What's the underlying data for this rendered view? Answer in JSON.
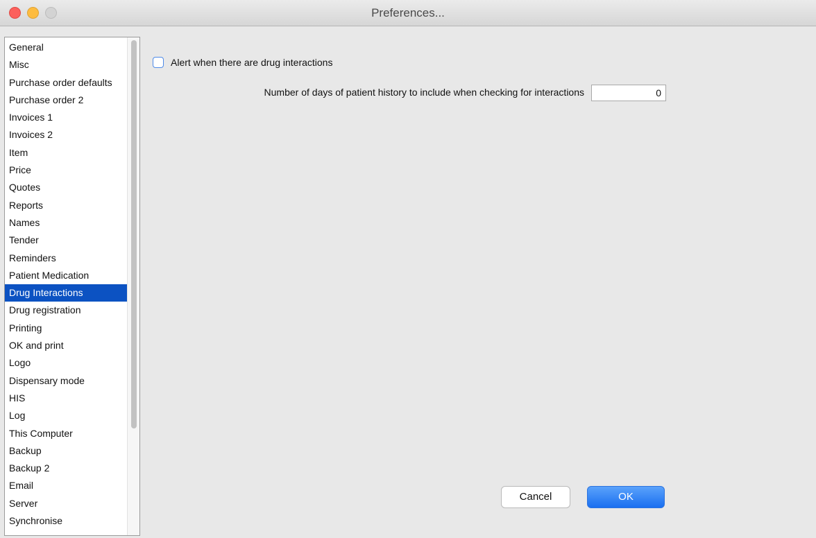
{
  "window": {
    "title": "Preferences..."
  },
  "sidebar": {
    "selected": "Drug Interactions",
    "items": [
      {
        "label": "General"
      },
      {
        "label": "Misc"
      },
      {
        "label": "Purchase order defaults"
      },
      {
        "label": "Purchase order 2"
      },
      {
        "label": "Invoices 1"
      },
      {
        "label": "Invoices 2"
      },
      {
        "label": "Item"
      },
      {
        "label": "Price"
      },
      {
        "label": "Quotes"
      },
      {
        "label": "Reports"
      },
      {
        "label": "Names"
      },
      {
        "label": "Tender"
      },
      {
        "label": "Reminders"
      },
      {
        "label": "Patient Medication"
      },
      {
        "label": "Drug Interactions"
      },
      {
        "label": "Drug registration"
      },
      {
        "label": "Printing"
      },
      {
        "label": "OK and print"
      },
      {
        "label": "Logo"
      },
      {
        "label": "Dispensary mode"
      },
      {
        "label": "HIS"
      },
      {
        "label": "Log"
      },
      {
        "label": "This Computer"
      },
      {
        "label": "Backup"
      },
      {
        "label": "Backup 2"
      },
      {
        "label": "Email"
      },
      {
        "label": "Server"
      },
      {
        "label": "Synchronise"
      }
    ]
  },
  "main": {
    "alert_checkbox": {
      "label": "Alert when there are drug interactions",
      "checked": false
    },
    "history_days": {
      "label": "Number of days of patient history to include when checking for interactions",
      "value": "0"
    }
  },
  "buttons": {
    "cancel": "Cancel",
    "ok": "OK"
  },
  "colors": {
    "selection": "#0c52c2",
    "primary_button": "#1a6ff0"
  }
}
